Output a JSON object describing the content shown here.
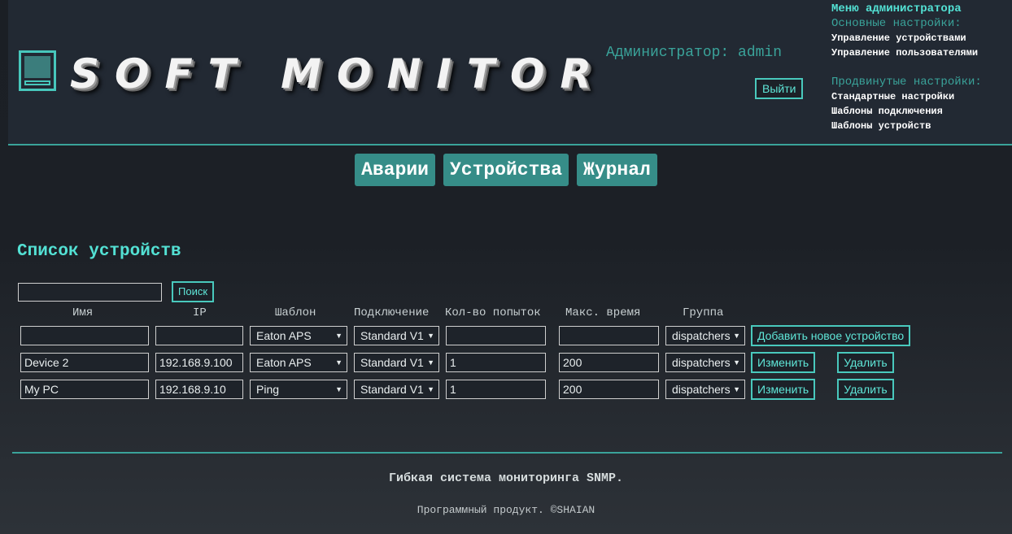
{
  "header": {
    "logo_text": "SOFT MONITOR",
    "admin_label": "Администратор: admin",
    "logout_label": "Выйти"
  },
  "admin_menu": {
    "title": "Меню администратора",
    "basic_title": "Основные настройки:",
    "basic_items": [
      "Управление устройствами",
      "Управление пользователями"
    ],
    "advanced_title": "Продвинутые настройки:",
    "advanced_items": [
      "Стандартные настройки",
      "Шаблоны подключения",
      "Шаблоны устройств"
    ]
  },
  "tabs": [
    {
      "label": "Аварии"
    },
    {
      "label": "Устройства"
    },
    {
      "label": "Журнал"
    }
  ],
  "devices": {
    "title": "Список устройств",
    "search": {
      "value": "",
      "button_label": "Поиск"
    },
    "columns": [
      "Имя",
      "IP",
      "Шаблон",
      "Подключение",
      "Кол-во попыток",
      "Макс. время",
      "Группа"
    ],
    "new_row": {
      "name": "",
      "ip": "",
      "template": "Eaton APS",
      "connection": "Standard V1",
      "attempts": "",
      "max_time": "",
      "group": "dispatchers",
      "add_label": "Добавить новое устройство"
    },
    "rows": [
      {
        "name": "Device 2",
        "ip": "192.168.9.100",
        "template": "Eaton APS",
        "connection": "Standard V1",
        "attempts": "1",
        "max_time": "200",
        "group": "dispatchers",
        "edit_label": "Изменить",
        "delete_label": "Удалить"
      },
      {
        "name": "My PC",
        "ip": "192.168.9.10",
        "template": "Ping",
        "connection": "Standard V1",
        "attempts": "1",
        "max_time": "200",
        "group": "dispatchers",
        "edit_label": "Изменить",
        "delete_label": "Удалить"
      }
    ]
  },
  "footer": {
    "tagline": "Гибкая система мониторинга SNMP.",
    "copyright": "Программный продукт. ©SHAIAN"
  },
  "colors": {
    "accent": "#3aa39a",
    "accent_bright": "#53e1d4",
    "tab_bg": "#368d88",
    "header_bg": "#222933"
  }
}
